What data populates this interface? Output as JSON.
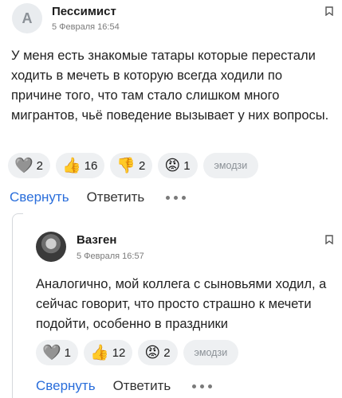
{
  "comment1": {
    "avatar_letter": "A",
    "author": "Пессимист",
    "date": "5 Февраля 16:54",
    "text": "У меня есть знакомые татары которые перестали ходить в мечеть в которую всегда ходили по причине того, что там стало слишком много мигрантов, чьё поведение вызывает у них вопросы.",
    "reactions": [
      {
        "icon": "heart-icon",
        "glyph": "🩶",
        "count": "2"
      },
      {
        "icon": "thumbs-up-icon",
        "glyph": "👍",
        "count": "16"
      },
      {
        "icon": "thumbs-down-icon",
        "glyph": "👎",
        "count": "2"
      },
      {
        "icon": "angry-face-icon",
        "glyph": "😡",
        "count": "1"
      }
    ],
    "emoji_label": "эмодзи",
    "collapse_label": "Свернуть",
    "reply_label": "Ответить"
  },
  "comment2": {
    "author": "Вазген",
    "date": "5 Февраля 16:57",
    "text": "Аналогично, мой коллега с сыновьями ходил, а сейчас говорит, что просто страшно к мечети подойти, особенно в праздники",
    "reactions": [
      {
        "icon": "heart-icon",
        "glyph": "🩶",
        "count": "1"
      },
      {
        "icon": "thumbs-up-icon",
        "glyph": "👍",
        "count": "12"
      },
      {
        "icon": "angry-face-icon",
        "glyph": "😡",
        "count": "2"
      }
    ],
    "emoji_label": "эмодзи",
    "collapse_label": "Свернуть",
    "reply_label": "Ответить"
  }
}
